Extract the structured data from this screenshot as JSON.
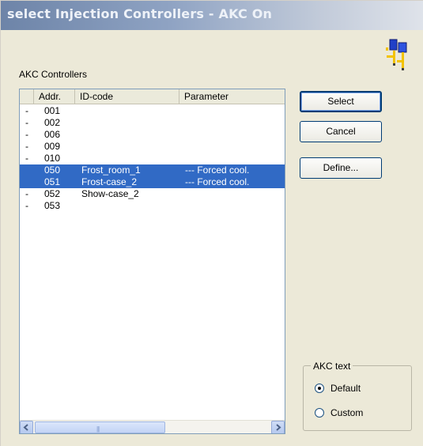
{
  "window": {
    "title": "select Injection Controllers - AKC On"
  },
  "icons": {
    "app_icon": "controllers-network-icon",
    "scroll_left": "arrow-left-icon",
    "scroll_right": "arrow-right-icon"
  },
  "list": {
    "group_label": "AKC Controllers",
    "columns": [
      "",
      "Addr.",
      "ID-code",
      "Parameter"
    ],
    "rows": [
      {
        "mark": "-",
        "addr": "001",
        "id": "",
        "param": "",
        "selected": false
      },
      {
        "mark": "-",
        "addr": "002",
        "id": "",
        "param": "",
        "selected": false
      },
      {
        "mark": "-",
        "addr": "006",
        "id": "",
        "param": "",
        "selected": false
      },
      {
        "mark": "-",
        "addr": "009",
        "id": "",
        "param": "",
        "selected": false
      },
      {
        "mark": "-",
        "addr": "010",
        "id": "",
        "param": "",
        "selected": false
      },
      {
        "mark": "",
        "addr": "050",
        "id": "Frost_room_1",
        "param": "--- Forced cool.",
        "selected": true
      },
      {
        "mark": "",
        "addr": "051",
        "id": "Frost-case_2",
        "param": "--- Forced cool.",
        "selected": true
      },
      {
        "mark": "-",
        "addr": "052",
        "id": "Show-case_2",
        "param": "",
        "selected": false
      },
      {
        "mark": "-",
        "addr": "053",
        "id": "",
        "param": "",
        "selected": false
      }
    ],
    "scroll_grip": "|||"
  },
  "buttons": {
    "select": "Select",
    "cancel": "Cancel",
    "define": "Define..."
  },
  "akc_text": {
    "label": "AKC text",
    "options": [
      {
        "label": "Default",
        "checked": true
      },
      {
        "label": "Custom",
        "checked": false
      }
    ]
  },
  "colors": {
    "selection": "#316ac5",
    "dialog_bg": "#ece9d8"
  }
}
